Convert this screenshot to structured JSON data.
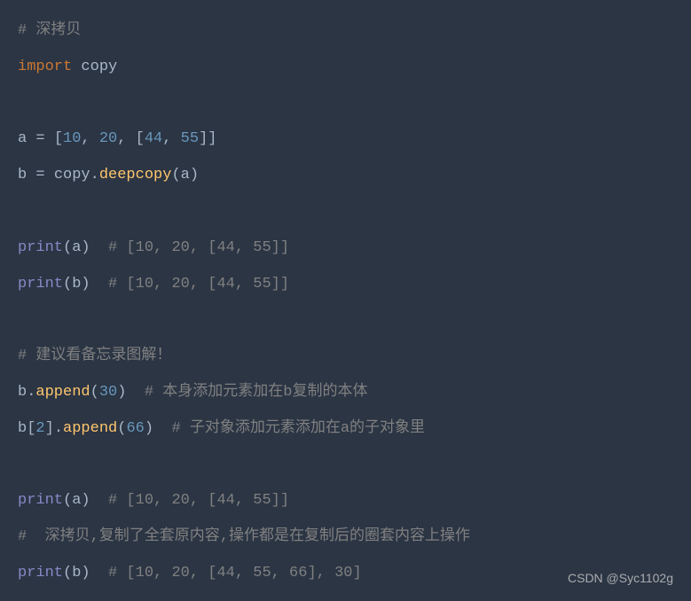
{
  "lines": {
    "l1_comment": "# 深拷贝",
    "l2_keyword": "import",
    "l2_module": " copy",
    "l4_var_a": "a ",
    "l4_eq": "= ",
    "l4_br1": "[",
    "l4_n1": "10",
    "l4_c1": ", ",
    "l4_n2": "20",
    "l4_c2": ", ",
    "l4_br2": "[",
    "l4_n3": "44",
    "l4_c3": ", ",
    "l4_n4": "55",
    "l4_br3": "]]",
    "l5_var_b": "b ",
    "l5_eq": "= ",
    "l5_mod": "copy",
    "l5_dot": ".",
    "l5_func": "deepcopy",
    "l5_p1": "(",
    "l5_arg": "a",
    "l5_p2": ")",
    "l7_print": "print",
    "l7_p1": "(",
    "l7_arg": "a",
    "l7_p2": ")",
    "l7_comment": "  # [10, 20, [44, 55]]",
    "l8_print": "print",
    "l8_p1": "(",
    "l8_arg": "b",
    "l8_p2": ")",
    "l8_comment": "  # [10, 20, [44, 55]]",
    "l10_comment": "# 建议看备忘录图解！",
    "l11_var": "b",
    "l11_dot": ".",
    "l11_func": "append",
    "l11_p1": "(",
    "l11_n": "30",
    "l11_p2": ")",
    "l11_comment": "  # 本身添加元素加在b复制的本体",
    "l12_var": "b",
    "l12_br1": "[",
    "l12_idx": "2",
    "l12_br2": "]",
    "l12_dot": ".",
    "l12_func": "append",
    "l12_p1": "(",
    "l12_n": "66",
    "l12_p2": ")",
    "l12_comment": "  # 子对象添加元素添加在a的子对象里",
    "l14_print": "print",
    "l14_p1": "(",
    "l14_arg": "a",
    "l14_p2": ")",
    "l14_comment": "  # [10, 20, [44, 55]]",
    "l15_comment": "#  深拷贝,复制了全套原内容,操作都是在复制后的圈套内容上操作",
    "l16_print": "print",
    "l16_p1": "(",
    "l16_arg": "b",
    "l16_p2": ")",
    "l16_comment": "  # [10, 20, [44, 55, 66], 30]"
  },
  "watermark": "CSDN @Syc1102g"
}
